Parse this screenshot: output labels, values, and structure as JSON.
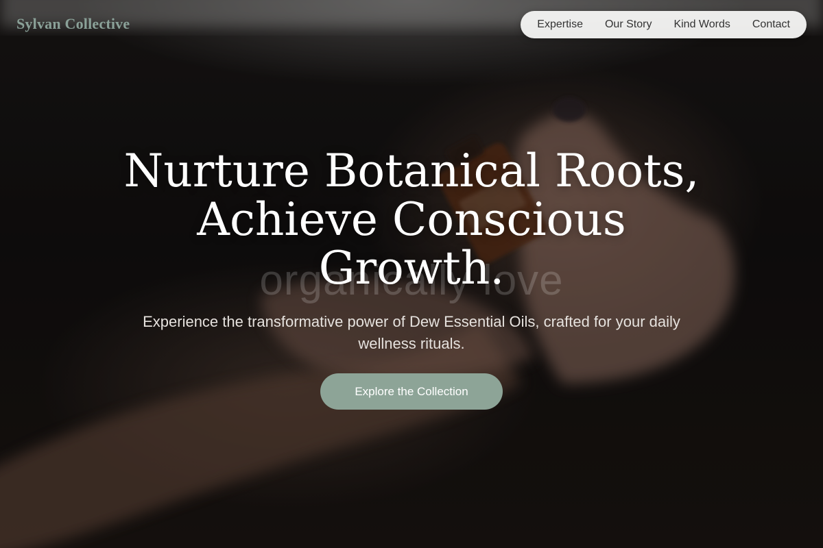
{
  "brand": {
    "name": "Sylvan Collective"
  },
  "nav": {
    "items": [
      {
        "label": "Expertise"
      },
      {
        "label": "Our Story"
      },
      {
        "label": "Kind Words"
      },
      {
        "label": "Contact"
      }
    ]
  },
  "hero": {
    "background_text": "organically love",
    "headline": "Nurture Botanical Roots, Achieve Conscious Growth.",
    "subheadline": "Experience the transformative power of Dew Essential Oils, crafted for your daily wellness rituals.",
    "cta_label": "Explore the Collection",
    "background_image_subject": "hands-holding-amber-essential-oil-bottle"
  },
  "colors": {
    "brand_text": "#8aa198",
    "nav_background": "#f4f4f2",
    "cta_background": "#8da497",
    "hero_text": "#ffffff"
  }
}
